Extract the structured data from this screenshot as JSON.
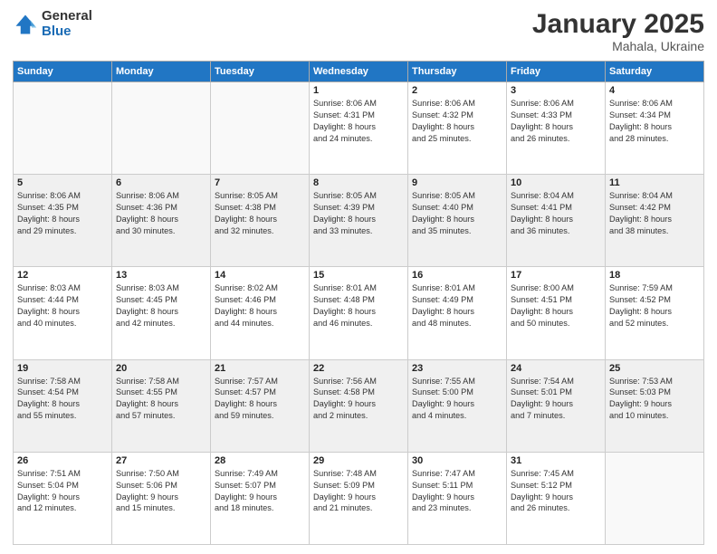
{
  "logo": {
    "general": "General",
    "blue": "Blue"
  },
  "title": "January 2025",
  "subtitle": "Mahala, Ukraine",
  "weekdays": [
    "Sunday",
    "Monday",
    "Tuesday",
    "Wednesday",
    "Thursday",
    "Friday",
    "Saturday"
  ],
  "weeks": [
    [
      {
        "day": "",
        "info": ""
      },
      {
        "day": "",
        "info": ""
      },
      {
        "day": "",
        "info": ""
      },
      {
        "day": "1",
        "info": "Sunrise: 8:06 AM\nSunset: 4:31 PM\nDaylight: 8 hours\nand 24 minutes."
      },
      {
        "day": "2",
        "info": "Sunrise: 8:06 AM\nSunset: 4:32 PM\nDaylight: 8 hours\nand 25 minutes."
      },
      {
        "day": "3",
        "info": "Sunrise: 8:06 AM\nSunset: 4:33 PM\nDaylight: 8 hours\nand 26 minutes."
      },
      {
        "day": "4",
        "info": "Sunrise: 8:06 AM\nSunset: 4:34 PM\nDaylight: 8 hours\nand 28 minutes."
      }
    ],
    [
      {
        "day": "5",
        "info": "Sunrise: 8:06 AM\nSunset: 4:35 PM\nDaylight: 8 hours\nand 29 minutes."
      },
      {
        "day": "6",
        "info": "Sunrise: 8:06 AM\nSunset: 4:36 PM\nDaylight: 8 hours\nand 30 minutes."
      },
      {
        "day": "7",
        "info": "Sunrise: 8:05 AM\nSunset: 4:38 PM\nDaylight: 8 hours\nand 32 minutes."
      },
      {
        "day": "8",
        "info": "Sunrise: 8:05 AM\nSunset: 4:39 PM\nDaylight: 8 hours\nand 33 minutes."
      },
      {
        "day": "9",
        "info": "Sunrise: 8:05 AM\nSunset: 4:40 PM\nDaylight: 8 hours\nand 35 minutes."
      },
      {
        "day": "10",
        "info": "Sunrise: 8:04 AM\nSunset: 4:41 PM\nDaylight: 8 hours\nand 36 minutes."
      },
      {
        "day": "11",
        "info": "Sunrise: 8:04 AM\nSunset: 4:42 PM\nDaylight: 8 hours\nand 38 minutes."
      }
    ],
    [
      {
        "day": "12",
        "info": "Sunrise: 8:03 AM\nSunset: 4:44 PM\nDaylight: 8 hours\nand 40 minutes."
      },
      {
        "day": "13",
        "info": "Sunrise: 8:03 AM\nSunset: 4:45 PM\nDaylight: 8 hours\nand 42 minutes."
      },
      {
        "day": "14",
        "info": "Sunrise: 8:02 AM\nSunset: 4:46 PM\nDaylight: 8 hours\nand 44 minutes."
      },
      {
        "day": "15",
        "info": "Sunrise: 8:01 AM\nSunset: 4:48 PM\nDaylight: 8 hours\nand 46 minutes."
      },
      {
        "day": "16",
        "info": "Sunrise: 8:01 AM\nSunset: 4:49 PM\nDaylight: 8 hours\nand 48 minutes."
      },
      {
        "day": "17",
        "info": "Sunrise: 8:00 AM\nSunset: 4:51 PM\nDaylight: 8 hours\nand 50 minutes."
      },
      {
        "day": "18",
        "info": "Sunrise: 7:59 AM\nSunset: 4:52 PM\nDaylight: 8 hours\nand 52 minutes."
      }
    ],
    [
      {
        "day": "19",
        "info": "Sunrise: 7:58 AM\nSunset: 4:54 PM\nDaylight: 8 hours\nand 55 minutes."
      },
      {
        "day": "20",
        "info": "Sunrise: 7:58 AM\nSunset: 4:55 PM\nDaylight: 8 hours\nand 57 minutes."
      },
      {
        "day": "21",
        "info": "Sunrise: 7:57 AM\nSunset: 4:57 PM\nDaylight: 8 hours\nand 59 minutes."
      },
      {
        "day": "22",
        "info": "Sunrise: 7:56 AM\nSunset: 4:58 PM\nDaylight: 9 hours\nand 2 minutes."
      },
      {
        "day": "23",
        "info": "Sunrise: 7:55 AM\nSunset: 5:00 PM\nDaylight: 9 hours\nand 4 minutes."
      },
      {
        "day": "24",
        "info": "Sunrise: 7:54 AM\nSunset: 5:01 PM\nDaylight: 9 hours\nand 7 minutes."
      },
      {
        "day": "25",
        "info": "Sunrise: 7:53 AM\nSunset: 5:03 PM\nDaylight: 9 hours\nand 10 minutes."
      }
    ],
    [
      {
        "day": "26",
        "info": "Sunrise: 7:51 AM\nSunset: 5:04 PM\nDaylight: 9 hours\nand 12 minutes."
      },
      {
        "day": "27",
        "info": "Sunrise: 7:50 AM\nSunset: 5:06 PM\nDaylight: 9 hours\nand 15 minutes."
      },
      {
        "day": "28",
        "info": "Sunrise: 7:49 AM\nSunset: 5:07 PM\nDaylight: 9 hours\nand 18 minutes."
      },
      {
        "day": "29",
        "info": "Sunrise: 7:48 AM\nSunset: 5:09 PM\nDaylight: 9 hours\nand 21 minutes."
      },
      {
        "day": "30",
        "info": "Sunrise: 7:47 AM\nSunset: 5:11 PM\nDaylight: 9 hours\nand 23 minutes."
      },
      {
        "day": "31",
        "info": "Sunrise: 7:45 AM\nSunset: 5:12 PM\nDaylight: 9 hours\nand 26 minutes."
      },
      {
        "day": "",
        "info": ""
      }
    ]
  ]
}
